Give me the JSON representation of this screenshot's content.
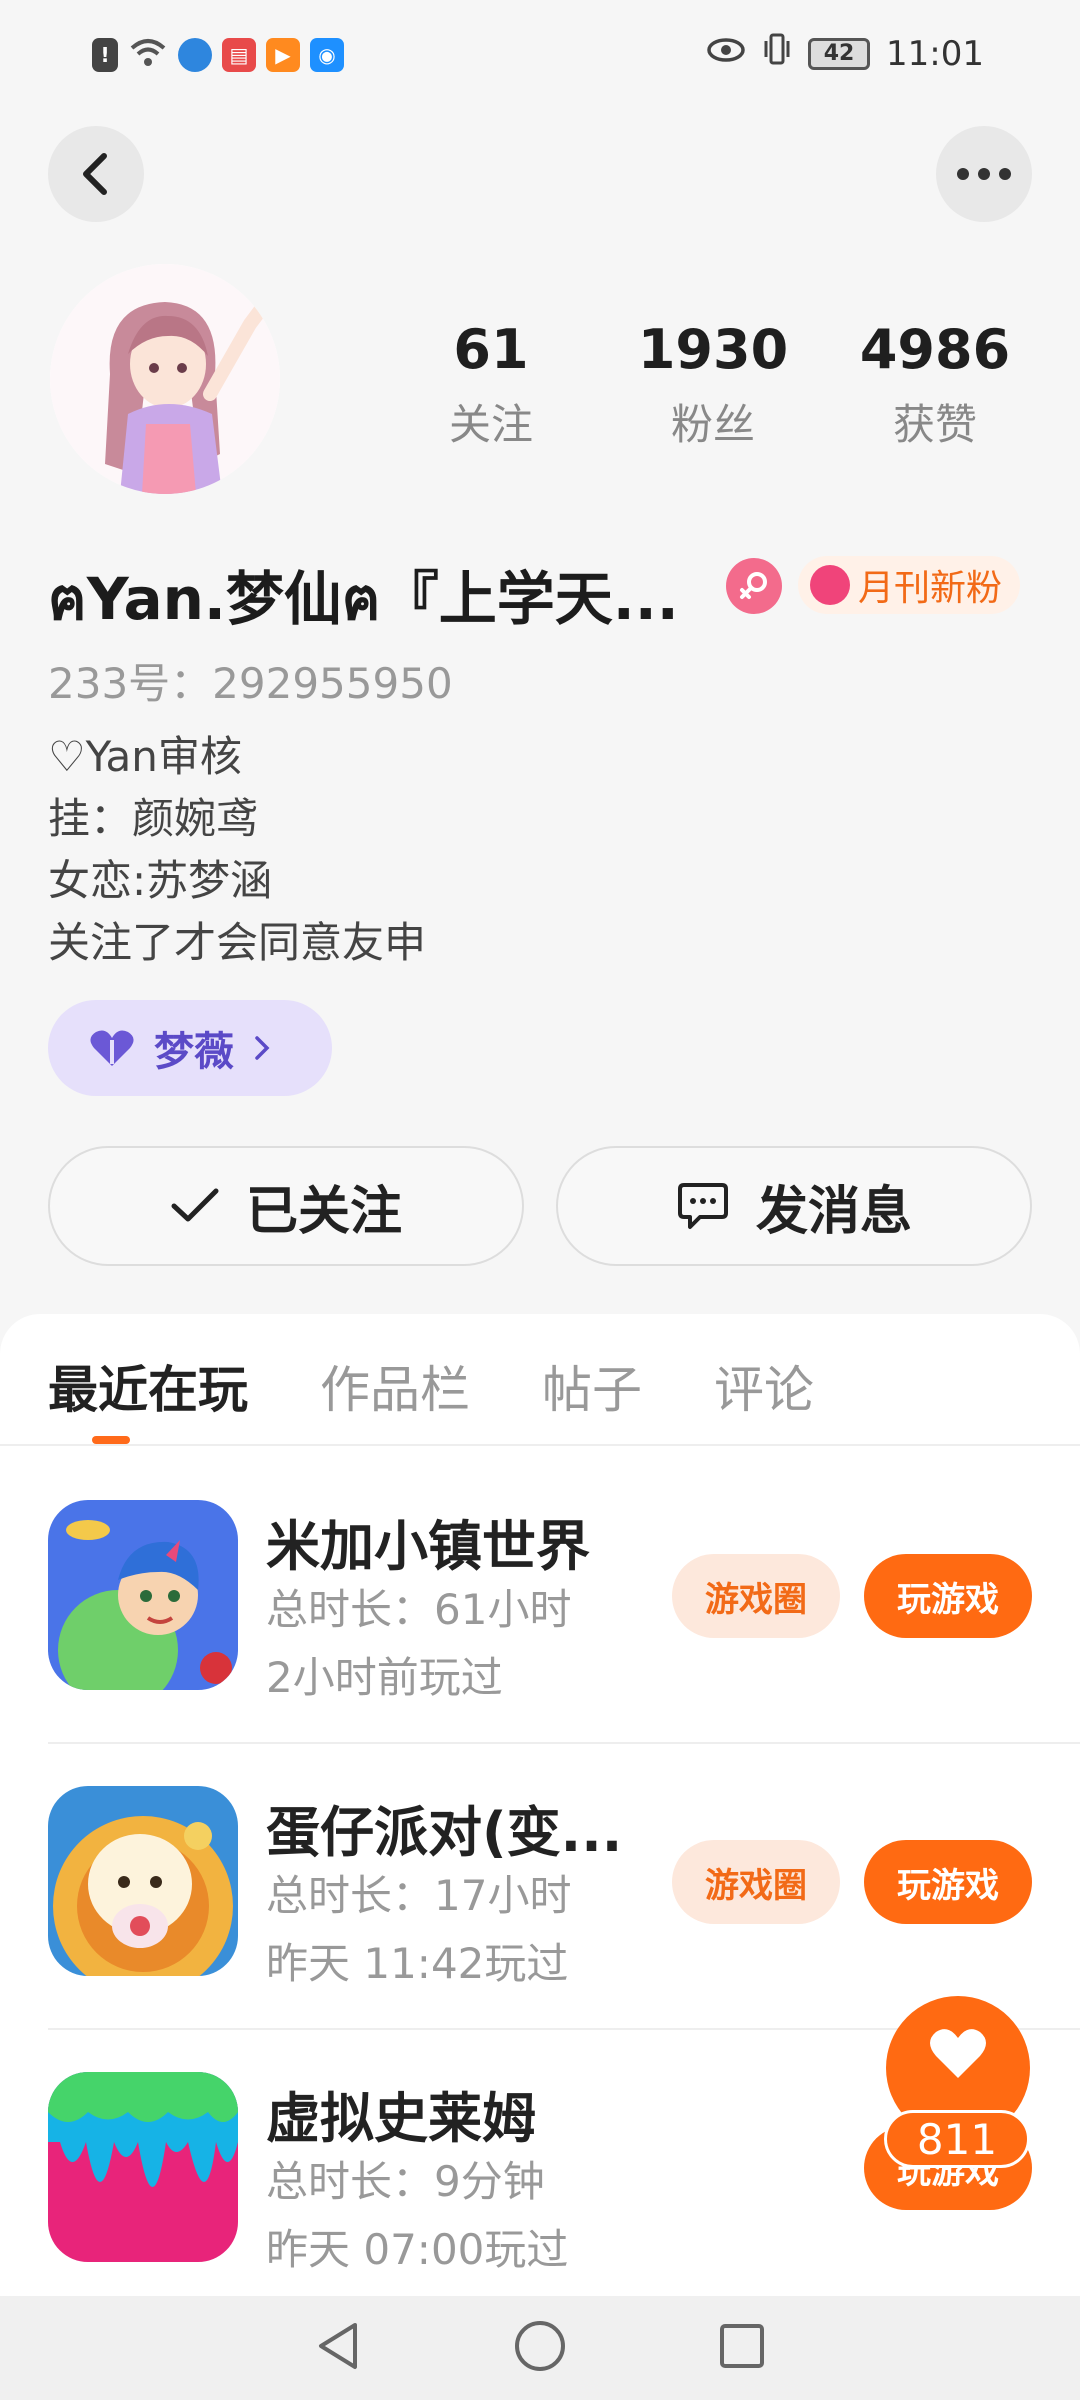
{
  "status_bar": {
    "battery": "42",
    "time": "11:01"
  },
  "profile": {
    "stats": [
      {
        "num": "61",
        "label": "关注"
      },
      {
        "num": "1930",
        "label": "粉丝"
      },
      {
        "num": "4986",
        "label": "获赞"
      }
    ],
    "nickname": "ฅYan.梦仙ฅ『上学天...",
    "badge_label": "月刊新粉",
    "uid": "233号：292955950",
    "bio": [
      "♡Yan审核",
      "挂：颜婉鸢",
      "女恋:苏梦涵",
      "关注了才会同意友申"
    ],
    "guild_name": "梦薇",
    "follow_label": "已关注",
    "message_label": "发消息"
  },
  "tabs": [
    "最近在玩",
    "作品栏",
    "帖子",
    "评论"
  ],
  "games": [
    {
      "title": "米加小镇世界",
      "duration": "总时长：61小时",
      "last_played": "2小时前玩过",
      "circle_label": "游戏圈",
      "play_label": "玩游戏"
    },
    {
      "title": "蛋仔派对(变...",
      "duration": "总时长：17小时",
      "last_played": "昨天 11:42玩过",
      "circle_label": "游戏圈",
      "play_label": "玩游戏"
    },
    {
      "title": "虚拟史莱姆",
      "duration": "总时长：9分钟",
      "last_played": "昨天 07:00玩过",
      "circle_label": "",
      "play_label": "玩游戏"
    }
  ],
  "like": {
    "count": "811"
  },
  "colors": {
    "accent": "#ff6a12",
    "guild_bg": "#e6e0fb",
    "gender": "#f36b8c"
  }
}
